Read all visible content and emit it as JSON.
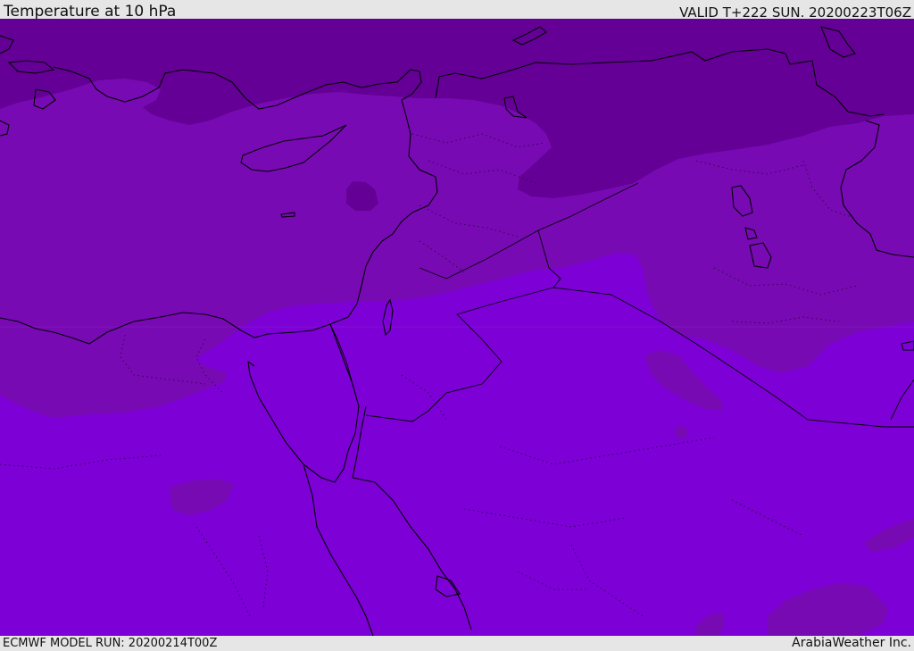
{
  "header": {
    "title": "Temperature at 10 hPa",
    "valid_time": "VALID T+222 SUN. 20200223T06Z"
  },
  "footer": {
    "model_run": "ECMWF MODEL RUN: 20200214T00Z",
    "credit": "ArabiaWeather Inc."
  },
  "map": {
    "colors": {
      "band_coldest": "#640096",
      "band_middle": "#780ab4",
      "band_warmest": "#7d00d7",
      "coast": "#000000",
      "borders": "#000000"
    }
  }
}
